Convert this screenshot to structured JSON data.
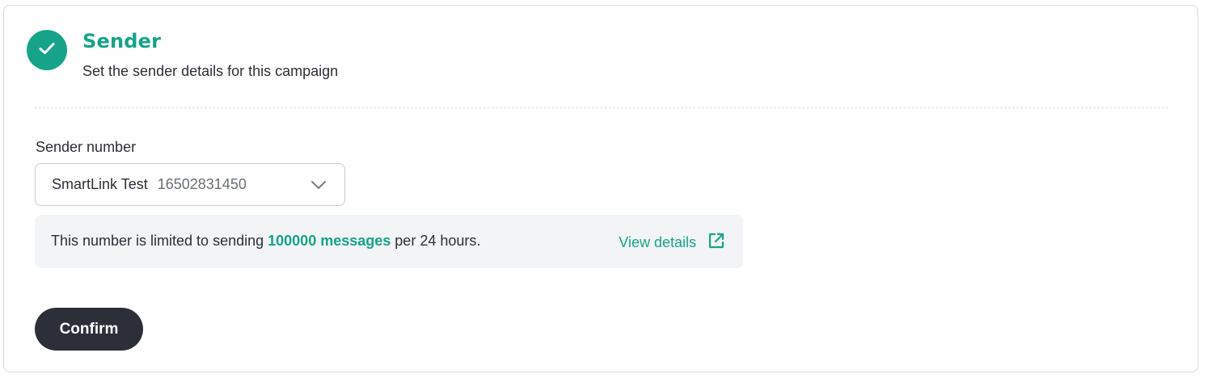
{
  "section": {
    "title": "Sender",
    "subtitle": "Set the sender details for this campaign",
    "status_icon": "check-icon",
    "accent_color": "#17a389"
  },
  "sender_field": {
    "label": "Sender number",
    "selected_name": "SmartLink Test",
    "selected_number": "16502831450",
    "dropdown_icon": "chevron-down-icon"
  },
  "limit_notice": {
    "text_before": "This number is limited to sending",
    "highlight": "100000 messages",
    "text_after": "per 24 hours.",
    "link_label": "View details",
    "link_icon": "external-link-icon"
  },
  "actions": {
    "confirm_label": "Confirm",
    "confirm_color": "#2c2f38"
  }
}
